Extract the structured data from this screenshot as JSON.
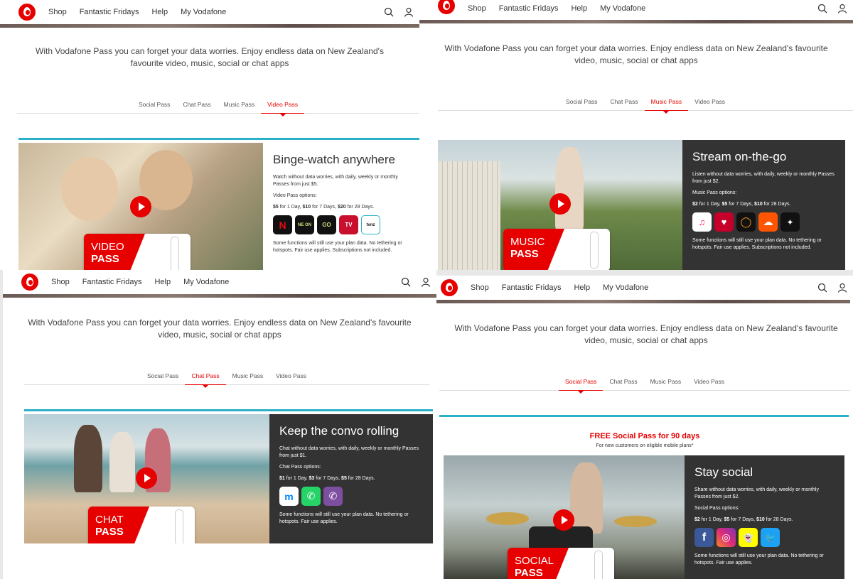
{
  "nav": {
    "items": [
      "Shop",
      "Fantastic Fridays",
      "Help",
      "My Vodafone"
    ],
    "search_icon": "search-icon",
    "user_icon": "user-icon"
  },
  "intro": "With Vodafone Pass you can forget your data worries. Enjoy endless data on New Zealand's favourite video, music, social or chat apps",
  "tabs": [
    "Social Pass",
    "Chat Pass",
    "Music Pass",
    "Video Pass"
  ],
  "colors": {
    "brand": "#e60000",
    "teal": "#2ab0c8",
    "dark_panel": "#333333"
  },
  "panels": {
    "video": {
      "active_tab": "Video Pass",
      "title": "Binge-watch anywhere",
      "desc": "Watch without data worries, with daily, weekly or monthly Passes from just $5.",
      "options_label": "Video Pass options:",
      "prices": [
        [
          "$5",
          " for 1 Day, "
        ],
        [
          "$10",
          " for 7 Days, "
        ],
        [
          "$20",
          " for 28 Days."
        ]
      ],
      "apps": [
        "N",
        "NE ON",
        "GO",
        "TV",
        "tvnz"
      ],
      "fine_print": "Some functions will still use your plan data. No tethering or hotspots. Fair use applies. Subscriptions not included.",
      "card_line1": "VIDEO",
      "card_line2": "PASS"
    },
    "music": {
      "active_tab": "Music Pass",
      "title": "Stream on-the-go",
      "desc": "Listen without data worries, with daily, weekly or monthly Passes from just $2.",
      "options_label": "Music Pass options:",
      "prices": [
        [
          "$2",
          " for 1 Day, "
        ],
        [
          "$5",
          " for 7 Days, "
        ],
        [
          "$10",
          " for 28 Days."
        ]
      ],
      "apps": [
        "♫",
        "♥",
        "◯",
        "☁",
        "✦"
      ],
      "fine_print": "Some functions will still use your plan data. No tethering or hotspots. Fair use applies. Subscriptions not included.",
      "card_line1": "MUSIC",
      "card_line2": "PASS"
    },
    "chat": {
      "active_tab": "Chat Pass",
      "title": "Keep the convo rolling",
      "desc": "Chat without data worries, with daily, weekly or monthly Passes from just $1.",
      "options_label": "Chat Pass options:",
      "prices": [
        [
          "$1",
          " for 1 Day, "
        ],
        [
          "$3",
          " for 7 Days, "
        ],
        [
          "$5",
          " for 28 Days."
        ]
      ],
      "apps": [
        "m",
        "✆",
        "✆"
      ],
      "fine_print": "Some functions will still use your plan data. No tethering or hotspots. Fair use applies.",
      "card_line1": "CHAT",
      "card_line2": "PASS"
    },
    "social": {
      "active_tab": "Social Pass",
      "promo_title": "FREE Social Pass for 90 days",
      "promo_sub": "For new customers on eligible mobile plans*",
      "title": "Stay social",
      "desc": "Share without data worries, with daily, weekly or monthly Passes from just $2.",
      "options_label": "Social Pass options:",
      "prices": [
        [
          "$2",
          " for 1 Day, "
        ],
        [
          "$5",
          " for 7 Days, "
        ],
        [
          "$10",
          " for 28 Days."
        ]
      ],
      "apps": [
        "f",
        "◎",
        "👻",
        "🐦"
      ],
      "fine_print": "Some functions will still use your plan data. No tethering or hotspots. Fair use applies.",
      "card_line1": "SOCIAL",
      "card_line2": "PASS"
    }
  }
}
